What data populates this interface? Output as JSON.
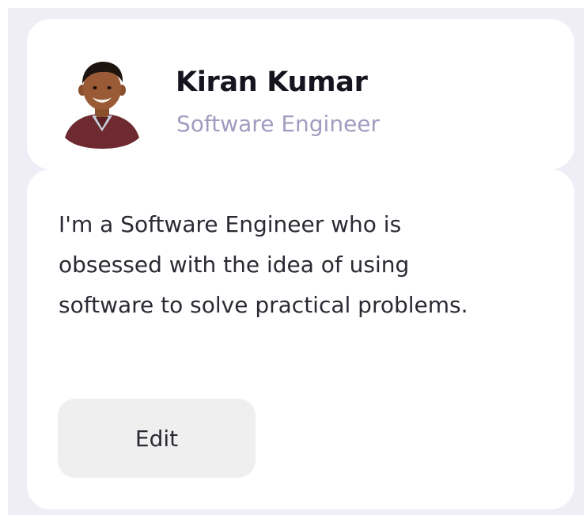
{
  "profile": {
    "name": "Kiran Kumar",
    "title": "Software Engineer",
    "avatar_icon": "person-photo-avatar"
  },
  "about": {
    "bio": "I'm a Software Engineer who is obsessed with the idea of using software to solve practical problems.",
    "edit_label": "Edit"
  },
  "colors": {
    "background": "#efeef7",
    "card": "#ffffff",
    "name": "#15141f",
    "subtitle": "#a19cbf",
    "body_text": "#2a2a33",
    "button_bg": "#efefef",
    "shirt": "#6e2a30"
  }
}
